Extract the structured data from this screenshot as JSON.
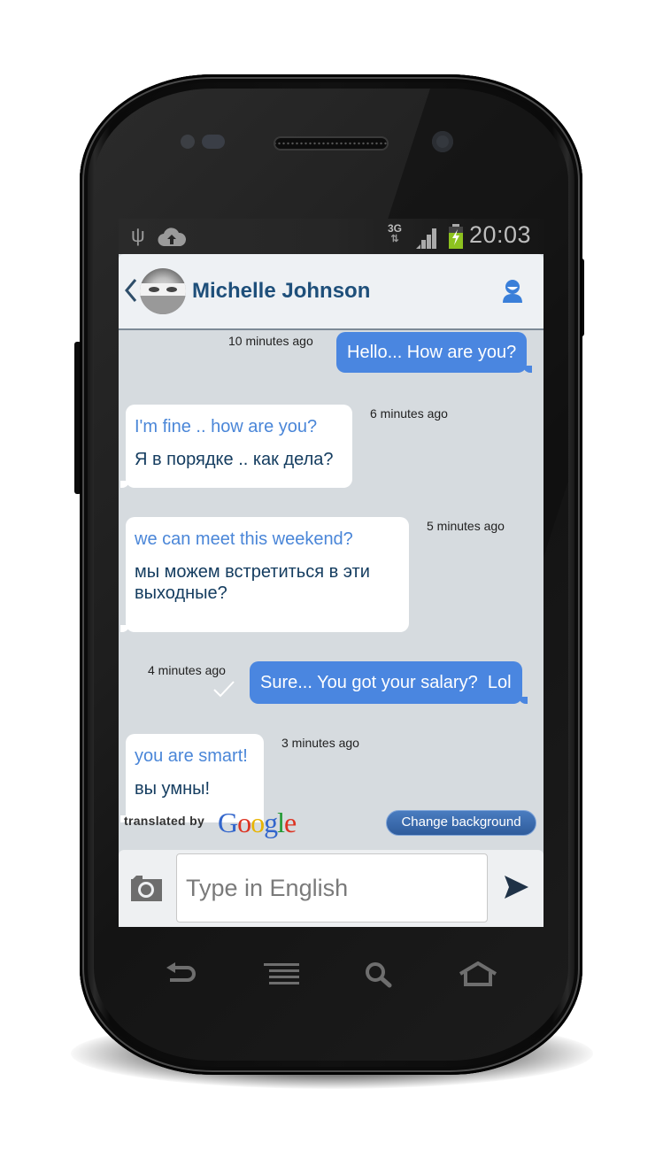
{
  "status_bar": {
    "time": "20:03",
    "network_type": "3G",
    "icons": [
      "usb-icon",
      "cloud-upload-icon",
      "3g-data-icon",
      "signal-icon",
      "battery-charging-icon"
    ]
  },
  "header": {
    "back_icon": "chevron-left-icon",
    "contact_name": "Michelle Johnson",
    "avatar_icon": "contact-avatar",
    "profile_icon": "person-icon"
  },
  "messages": [
    {
      "direction": "outgoing",
      "text": "Hello... How are you?",
      "timestamp": "10 minutes ago"
    },
    {
      "direction": "incoming",
      "original": "I'm fine .. how are you?",
      "translation": "Я в порядке .. как дела?",
      "timestamp": "6 minutes ago"
    },
    {
      "direction": "incoming",
      "original": "we can meet this weekend?",
      "translation": "мы можем встретиться в эти выходные?",
      "timestamp": "5 minutes ago"
    },
    {
      "direction": "outgoing",
      "text": "Sure... You got your salary?  Lol",
      "timestamp": "4 minutes ago",
      "delivered": true
    },
    {
      "direction": "incoming",
      "original": "you are smart!",
      "translation": "вы умны!",
      "timestamp": "3 minutes ago"
    }
  ],
  "footer": {
    "translated_by": "translated by",
    "google_letters": [
      {
        "ch": "G",
        "color": "#3366cc"
      },
      {
        "ch": "o",
        "color": "#dd3322"
      },
      {
        "ch": "o",
        "color": "#e8b400"
      },
      {
        "ch": "g",
        "color": "#3366cc"
      },
      {
        "ch": "l",
        "color": "#229933"
      },
      {
        "ch": "e",
        "color": "#dd3322"
      }
    ],
    "change_background": "Change background"
  },
  "composer": {
    "placeholder": "Type in English",
    "value": "",
    "camera_icon": "camera-icon",
    "send_icon": "send-icon"
  },
  "nav_bar": {
    "buttons": [
      "back-icon",
      "menu-icon",
      "search-icon",
      "home-icon"
    ]
  },
  "colors": {
    "outgoing_bubble": "#4a86e0",
    "incoming_original_text": "#4a86d8",
    "incoming_translation_text": "#153d60",
    "contact_name": "#1e4f7a",
    "chat_background": "#d6dbdf"
  }
}
